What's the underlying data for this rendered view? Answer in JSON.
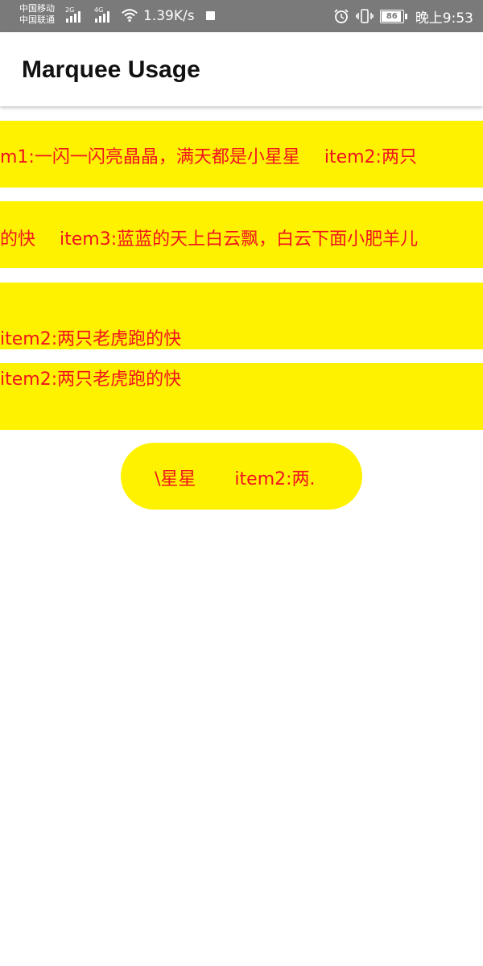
{
  "status_bar": {
    "carrier1": "中国移动",
    "carrier2": "中国联通",
    "sig1_tag": "2G",
    "sig2_tag": "4G",
    "speed": "1.39K/s",
    "battery": "86",
    "time": "晚上9:53"
  },
  "app_bar": {
    "title": "Marquee Usage"
  },
  "marquees": {
    "m1": {
      "a": "m1:一闪一闪亮晶晶，满天都是小星星",
      "b": "item2:两只"
    },
    "m2": {
      "a": "的快",
      "b": "item3:蓝蓝的天上白云飘，白云下面小肥羊儿"
    },
    "m3": {
      "a": "item2:两只老虎跑的快"
    },
    "m4": {
      "a": "item2:两只老虎跑的快"
    },
    "pill": {
      "a": "\\星星",
      "b": "item2:两."
    }
  },
  "colors": {
    "marquee_bg": "#fff200",
    "marquee_text": "#f0141e",
    "status_bar": "#7a7a7a"
  }
}
